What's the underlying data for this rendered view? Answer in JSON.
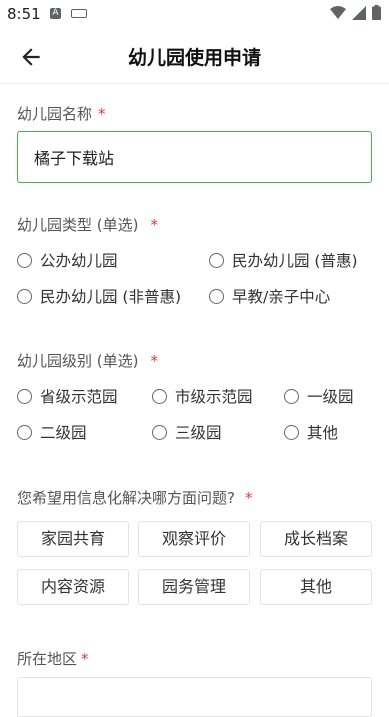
{
  "status": {
    "time": "8:51"
  },
  "header": {
    "title": "幼儿园使用申请"
  },
  "form": {
    "name": {
      "label": "幼儿园名称",
      "required": "*",
      "value": "橘子下载站"
    },
    "type": {
      "label": "幼儿园类型 (单选)",
      "required": "*",
      "options": [
        "公办幼儿园",
        "民办幼儿园 (普惠)",
        "民办幼儿园 (非普惠)",
        "早教/亲子中心"
      ]
    },
    "level": {
      "label": "幼儿园级别 (单选)",
      "required": "*",
      "options": [
        "省级示范园",
        "市级示范园",
        "一级园",
        "二级园",
        "三级园",
        "其他"
      ]
    },
    "problems": {
      "label": "您希望用信息化解决哪方面问题?",
      "required": "*",
      "options": [
        "家园共育",
        "观察评价",
        "成长档案",
        "内容资源",
        "园务管理",
        "其他"
      ]
    },
    "region": {
      "label": "所在地区",
      "required": "*"
    }
  },
  "colors": {
    "accent_border": "#4caf50",
    "required": "#e53935"
  },
  "icons": [
    "back-arrow-icon",
    "wifi-icon",
    "signal-icon",
    "battery-icon",
    "notification-a-icon",
    "keyboard-icon"
  ]
}
